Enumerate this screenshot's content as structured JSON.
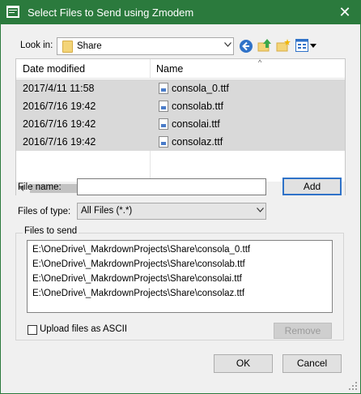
{
  "window": {
    "title": "Select Files to Send using Zmodem",
    "close_glyph": "✕"
  },
  "toolbar": {
    "look_in_label": "Look in:",
    "look_in_value": "Share",
    "icons": [
      "back-icon",
      "up-folder-icon",
      "new-folder-icon",
      "view-menu-icon"
    ]
  },
  "file_list": {
    "columns": [
      "Date modified",
      "Name"
    ],
    "sort_glyph": "^",
    "rows": [
      {
        "date": "2017/4/11 11:58",
        "name": "consola_0.ttf"
      },
      {
        "date": "2016/7/16 19:42",
        "name": "consolab.ttf"
      },
      {
        "date": "2016/7/16 19:42",
        "name": "consolai.ttf"
      },
      {
        "date": "2016/7/16 19:42",
        "name": "consolaz.ttf"
      }
    ]
  },
  "file_name": {
    "label": "File name:",
    "value": "",
    "add_label": "Add"
  },
  "file_type": {
    "label": "Files of type:",
    "value": "All Files (*.*)"
  },
  "files_to_send": {
    "group_label": "Files to send",
    "items": [
      "E:\\OneDrive\\_MakrdownProjects\\Share\\consola_0.ttf",
      "E:\\OneDrive\\_MakrdownProjects\\Share\\consolab.ttf",
      "E:\\OneDrive\\_MakrdownProjects\\Share\\consolai.ttf",
      "E:\\OneDrive\\_MakrdownProjects\\Share\\consolaz.ttf"
    ]
  },
  "options": {
    "ascii_label": "Upload files as ASCII",
    "ascii_checked": false,
    "remove_label": "Remove"
  },
  "footer": {
    "ok_label": "OK",
    "cancel_label": "Cancel"
  },
  "colors": {
    "titlebar": "#2b7a3d",
    "dialog_bg": "#f0f0f0",
    "selected_row": "#d9d9d9",
    "default_button_border": "#2f72c8"
  }
}
